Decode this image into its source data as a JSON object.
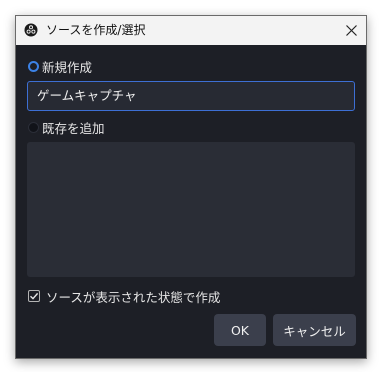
{
  "window": {
    "title": "ソースを作成/選択",
    "app_icon": "obs-logo-icon",
    "close_icon": "close-icon"
  },
  "create_new": {
    "label": "新規作成",
    "selected": true,
    "name_value": "ゲームキャプチャ"
  },
  "add_existing": {
    "label": "既存を追加",
    "selected": false,
    "items": []
  },
  "visible_checkbox": {
    "label": "ソースが表示された状態で作成",
    "checked": true
  },
  "buttons": {
    "ok_label": "OK",
    "cancel_label": "キャンセル"
  },
  "colors": {
    "background": "#1d1f26",
    "input_focus_border": "#3d6fd4",
    "button": "#3b3f4c",
    "radio_accent": "#3c82e6"
  }
}
